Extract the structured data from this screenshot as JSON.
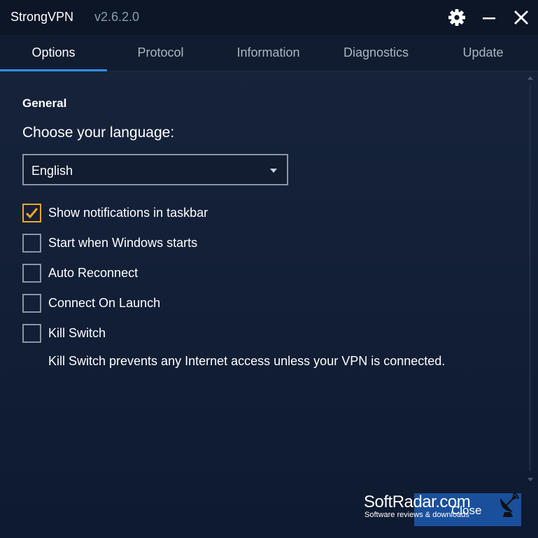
{
  "window": {
    "app_name": "StrongVPN",
    "version": "v2.6.2.0"
  },
  "titlebar": {
    "settings_icon": "gear-icon",
    "minimize_icon": "minimize-icon",
    "close_icon": "close-icon"
  },
  "tabs": [
    {
      "label": "Options",
      "active": true
    },
    {
      "label": "Protocol",
      "active": false
    },
    {
      "label": "Information",
      "active": false
    },
    {
      "label": "Diagnostics",
      "active": false
    },
    {
      "label": "Update",
      "active": false
    }
  ],
  "general": {
    "section_title": "General",
    "language_label": "Choose your language:",
    "language_selected": "English",
    "options": [
      {
        "label": "Show notifications in taskbar",
        "checked": true
      },
      {
        "label": "Start when Windows starts",
        "checked": false
      },
      {
        "label": "Auto Reconnect",
        "checked": false
      },
      {
        "label": "Connect On Launch",
        "checked": false
      },
      {
        "label": "Kill Switch",
        "checked": false
      }
    ],
    "kill_switch_description": "Kill Switch prevents any Internet access unless your VPN is connected."
  },
  "footer": {
    "close_label": "Close"
  },
  "watermark": {
    "title": "SoftRadar.com",
    "subtitle": "Software reviews & downloads",
    "icon": "satellite-dish-icon"
  },
  "colors": {
    "accent_blue": "#2f8fff",
    "check_orange": "#f5a623",
    "close_button": "#1a4f9b"
  }
}
